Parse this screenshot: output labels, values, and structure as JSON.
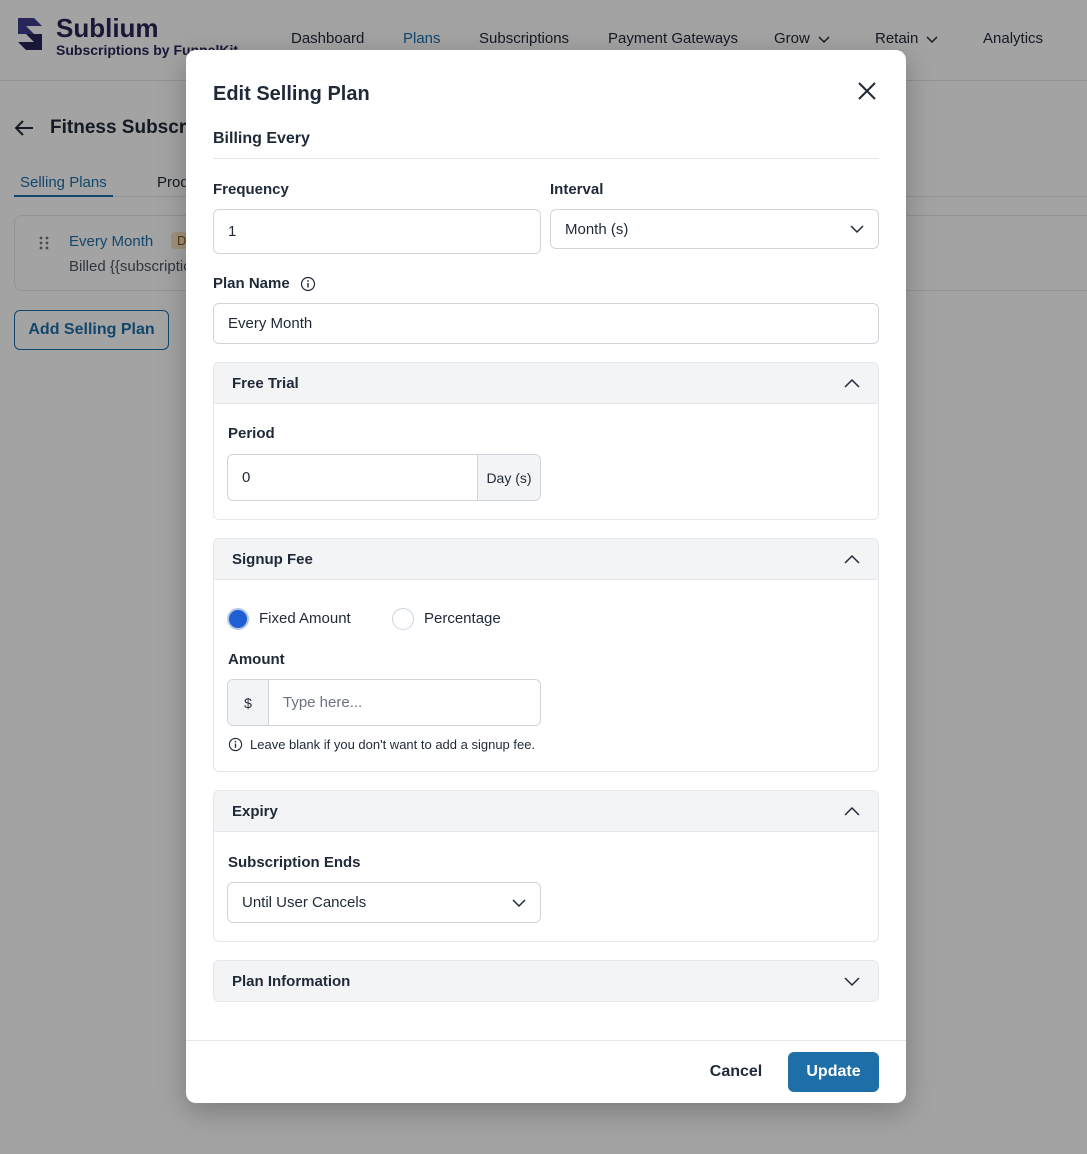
{
  "app": {
    "logo_title": "Sublium",
    "logo_subtitle": "Subscriptions by FunnelKit",
    "brand_color": "#262457",
    "accent_color": "#1e6ea8"
  },
  "nav": {
    "items": [
      {
        "label": "Dashboard",
        "active": false,
        "has_dropdown": false
      },
      {
        "label": "Plans",
        "active": true,
        "has_dropdown": false
      },
      {
        "label": "Subscriptions",
        "active": false,
        "has_dropdown": false
      },
      {
        "label": "Payment Gateways",
        "active": false,
        "has_dropdown": false
      },
      {
        "label": "Grow",
        "active": false,
        "has_dropdown": true
      },
      {
        "label": "Retain",
        "active": false,
        "has_dropdown": true
      },
      {
        "label": "Analytics",
        "active": false,
        "has_dropdown": false
      }
    ]
  },
  "page": {
    "title": "Fitness Subscription",
    "tabs": [
      {
        "label": "Selling Plans",
        "active": true
      },
      {
        "label": "Products",
        "active": false
      }
    ],
    "plan_card": {
      "name": "Every Month",
      "badge": "Default",
      "billed": "Billed {{subscription_price}}"
    },
    "add_button": "Add Selling Plan"
  },
  "modal": {
    "title": "Edit Selling Plan",
    "billing_section": "Billing Every",
    "frequency": {
      "label": "Frequency",
      "value": "1"
    },
    "interval": {
      "label": "Interval",
      "value": "Month (s)"
    },
    "plan_name": {
      "label": "Plan Name",
      "value": "Every Month"
    },
    "free_trial": {
      "title": "Free Trial",
      "period_label": "Period",
      "period_value": "0",
      "period_unit": "Day (s)"
    },
    "signup_fee": {
      "title": "Signup Fee",
      "options": [
        {
          "label": "Fixed Amount",
          "checked": true
        },
        {
          "label": "Percentage",
          "checked": false
        }
      ],
      "amount_label": "Amount",
      "currency": "$",
      "amount_placeholder": "Type here...",
      "help": "Leave blank if you don't want to add a signup fee."
    },
    "expiry": {
      "title": "Expiry",
      "ends_label": "Subscription Ends",
      "ends_value": "Until User Cancels"
    },
    "plan_information": {
      "title": "Plan Information"
    },
    "cancel_label": "Cancel",
    "update_label": "Update"
  }
}
